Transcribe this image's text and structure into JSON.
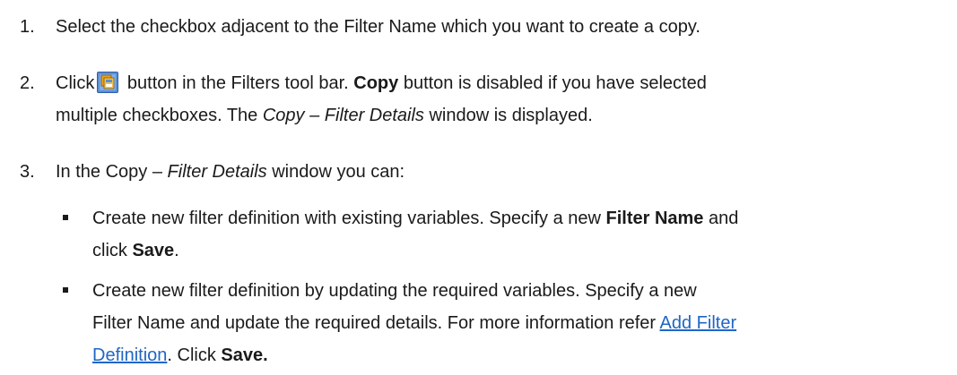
{
  "steps": [
    {
      "number": "1.",
      "line1": "Select the checkbox adjacent to the Filter Name which you want to create a copy."
    },
    {
      "number": "2.",
      "prefix": "Click",
      "icon": "copy-icon",
      "after_icon": " button in the Filters tool bar. ",
      "bold_copy": "Copy",
      "after_copy": " button is disabled if you have selected",
      "line2_pre": "multiple checkboxes. The ",
      "line2_italic": "Copy – Filter Details",
      "line2_post": " window is displayed."
    },
    {
      "number": "3.",
      "pre": "In the Copy – ",
      "italic": "Filter Details",
      "post": " window you can:"
    }
  ],
  "bullets": [
    {
      "line1_pre": "Create new filter definition with existing variables. Specify a new ",
      "line1_bold": "Filter Name",
      "line1_post": " and",
      "line2_pre": "click ",
      "line2_bold": "Save",
      "line2_post": "."
    },
    {
      "line1": "Create new filter definition by updating the required variables. Specify a new",
      "line2_pre": "Filter Name and update the required details. For more information refer ",
      "link_part1": "Add Filter",
      "link_part2": "Definition",
      "line3_post": ". Click ",
      "line3_bold": "Save."
    }
  ],
  "colors": {
    "text": "#1a1a1a",
    "link": "#1f66c6",
    "icon_bg": "#5b8fd6",
    "icon_fg": "#e8a020"
  }
}
